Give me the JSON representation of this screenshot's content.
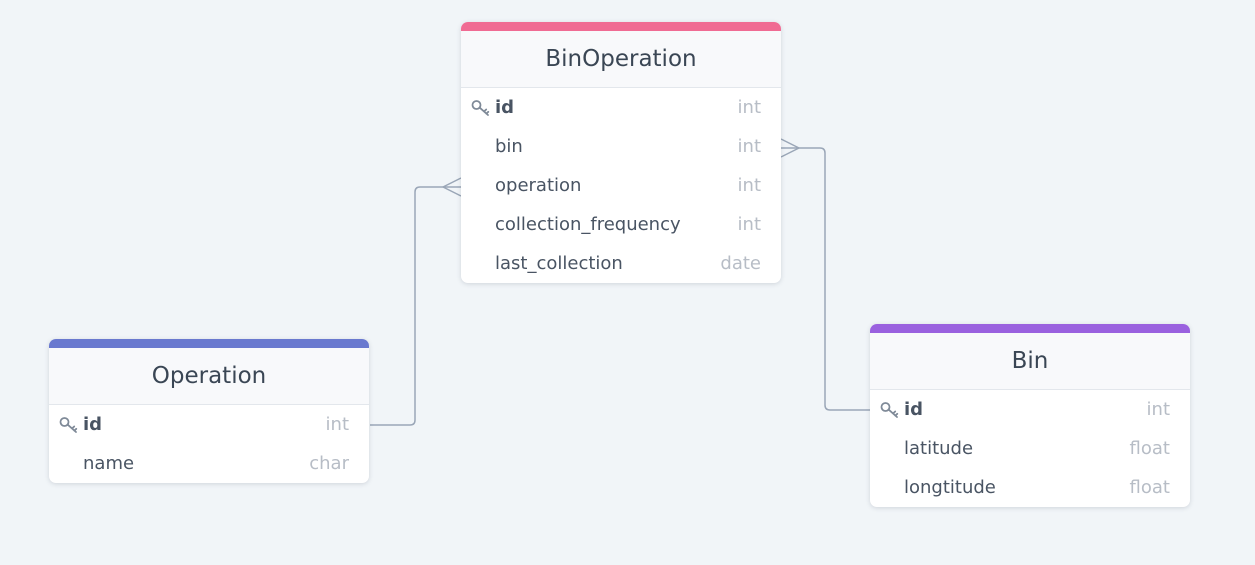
{
  "colors": {
    "background": "#f1f5f8",
    "connector": "#9aa6b7",
    "binoperation_accent": "#f06b93",
    "operation_accent": "#6979cf",
    "bin_accent": "#9a61df"
  },
  "tables": {
    "binoperation": {
      "title": "BinOperation",
      "fields": [
        {
          "name": "id",
          "type": "int",
          "primary_key": true,
          "icon": "key-icon"
        },
        {
          "name": "bin",
          "type": "int"
        },
        {
          "name": "operation",
          "type": "int"
        },
        {
          "name": "collection_frequency",
          "type": "int"
        },
        {
          "name": "last_collection",
          "type": "date"
        }
      ]
    },
    "operation": {
      "title": "Operation",
      "fields": [
        {
          "name": "id",
          "type": "int",
          "primary_key": true,
          "icon": "key-icon"
        },
        {
          "name": "name",
          "type": "char"
        }
      ]
    },
    "bin": {
      "title": "Bin",
      "fields": [
        {
          "name": "id",
          "type": "int",
          "primary_key": true,
          "icon": "key-icon"
        },
        {
          "name": "latitude",
          "type": "float"
        },
        {
          "name": "longtitude",
          "type": "float"
        }
      ]
    }
  },
  "relationships": [
    {
      "from": "binoperation.operation",
      "to": "operation.id",
      "cardinality": "many-to-one"
    },
    {
      "from": "binoperation.bin",
      "to": "bin.id",
      "cardinality": "many-to-one"
    }
  ]
}
